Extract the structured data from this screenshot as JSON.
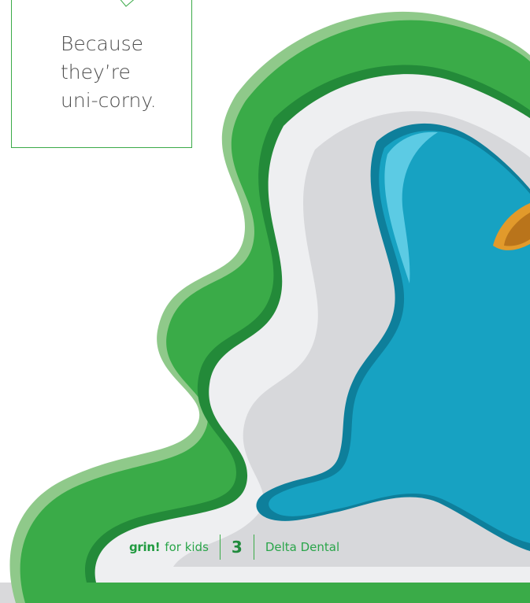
{
  "bubble": {
    "lines": [
      "Because",
      "they’re",
      "uni-corny."
    ]
  },
  "footer": {
    "brand": "grin!",
    "tagline": "for kids",
    "page_number": "3",
    "publisher": "Delta Dental"
  },
  "colors": {
    "green": "#3aab48",
    "green_dark": "#238a39",
    "white_band": "#eeeff1",
    "blue": "#17a2c2",
    "blue_dark": "#0e7f9b",
    "horn": "#e29a2b"
  }
}
